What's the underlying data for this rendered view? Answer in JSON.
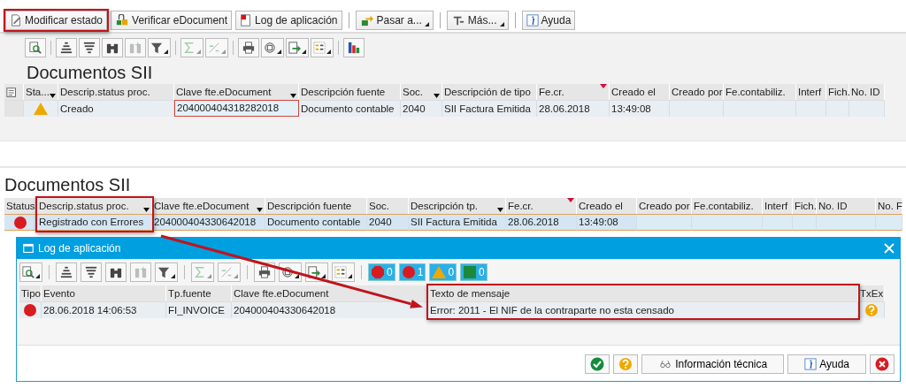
{
  "toolbar": [
    {
      "kind": "edit",
      "label": "Modificar estado",
      "dropdown": false,
      "separator_before": false,
      "highlighted": true
    },
    {
      "kind": "verify",
      "label": "Verificar eDocument",
      "dropdown": false,
      "separator_before": false,
      "highlighted": false
    },
    {
      "kind": "log",
      "label": "Log de aplicación",
      "dropdown": false,
      "separator_before": false,
      "highlighted": false
    },
    {
      "kind": "forward",
      "label": "Pasar a...",
      "dropdown": true,
      "separator_before": true,
      "highlighted": false
    },
    {
      "kind": "more",
      "label": "Más...",
      "dropdown": true,
      "separator_before": true,
      "highlighted": false
    },
    {
      "kind": "info",
      "label": "Ayuda",
      "dropdown": false,
      "separator_before": true,
      "highlighted": false
    }
  ],
  "first_list": {
    "alv_toolbar": [
      {
        "kind": "details",
        "dropdown": false,
        "disabled": false
      },
      {
        "kind": "separator"
      },
      {
        "kind": "sort_up",
        "dropdown": false,
        "disabled": false
      },
      {
        "kind": "sort_down",
        "dropdown": false,
        "disabled": false
      },
      {
        "kind": "find",
        "dropdown": false,
        "disabled": false
      },
      {
        "kind": "find_next",
        "dropdown": false,
        "disabled": true
      },
      {
        "kind": "filter",
        "dropdown": true,
        "disabled": false
      },
      {
        "kind": "separator"
      },
      {
        "kind": "sum",
        "dropdown": true,
        "disabled": true
      },
      {
        "kind": "subtotal",
        "dropdown": true,
        "disabled": true
      },
      {
        "kind": "separator"
      },
      {
        "kind": "print",
        "dropdown": false,
        "disabled": false
      },
      {
        "kind": "view",
        "dropdown": true,
        "disabled": false
      },
      {
        "kind": "export",
        "dropdown": true,
        "disabled": false
      },
      {
        "kind": "layout",
        "dropdown": true,
        "disabled": false
      },
      {
        "kind": "separator"
      },
      {
        "kind": "chart",
        "dropdown": false,
        "disabled": false
      }
    ],
    "title": "Documentos SII",
    "table": {
      "row_selector": true,
      "columns": [
        {
          "label": "Sta...",
          "filtered": true,
          "sorted": false,
          "highlighted": false
        },
        {
          "label": "Descrip.status proc.",
          "filtered": false,
          "sorted": false,
          "highlighted": false
        },
        {
          "label": "Clave fte.eDocument",
          "filtered": true,
          "sorted": false,
          "highlighted": false
        },
        {
          "label": "Descripción fuente",
          "filtered": false,
          "sorted": false,
          "highlighted": false
        },
        {
          "label": "Soc.",
          "filtered": true,
          "sorted": false,
          "highlighted": false
        },
        {
          "label": "Descripción de tipo",
          "filtered": false,
          "sorted": false,
          "highlighted": false
        },
        {
          "label": "Fe.cr.",
          "filtered": false,
          "sorted": true,
          "highlighted": false
        },
        {
          "label": "Creado el",
          "filtered": false,
          "sorted": false,
          "highlighted": false
        },
        {
          "label": "Creado por",
          "filtered": false,
          "sorted": false,
          "highlighted": false
        },
        {
          "label": "Fe.contabiliz.",
          "filtered": false,
          "sorted": false,
          "highlighted": false
        },
        {
          "label": "Interf",
          "filtered": false,
          "sorted": false,
          "highlighted": false
        },
        {
          "label": "Fich.",
          "filtered": false,
          "sorted": false,
          "highlighted": false
        },
        {
          "label": "No. ID",
          "filtered": false,
          "sorted": false,
          "highlighted": false
        }
      ],
      "rows": [
        {
          "selected": false,
          "cells": [
            {
              "kind": "warning"
            },
            {
              "text": "Creado",
              "focused": false
            },
            {
              "text": "204000404318282018",
              "focused": true
            },
            {
              "text": "Documento contable",
              "focused": false
            },
            {
              "text": "2040",
              "focused": false
            },
            {
              "text": "SII Factura Emitida",
              "focused": false
            },
            {
              "text": "28.06.2018",
              "focused": false
            },
            {
              "text": "13:49:08",
              "focused": false
            }
          ]
        }
      ]
    }
  },
  "second_list": {
    "title": "Documentos SII",
    "table": {
      "columns": [
        {
          "label": "Status",
          "filtered": false,
          "sorted": false,
          "highlighted": false
        },
        {
          "label": "Descrip.status proc.",
          "filtered": true,
          "sorted": false,
          "highlighted": true
        },
        {
          "label": "Clave fte.eDocument",
          "filtered": true,
          "sorted": false,
          "highlighted": false
        },
        {
          "label": "Descripción fuente",
          "filtered": false,
          "sorted": false,
          "highlighted": false
        },
        {
          "label": "Soc.",
          "filtered": false,
          "sorted": false,
          "highlighted": false
        },
        {
          "label": "Descripción tp.",
          "filtered": true,
          "sorted": false,
          "highlighted": false
        },
        {
          "label": "Fe.cr.",
          "filtered": false,
          "sorted": true,
          "highlighted": false
        },
        {
          "label": "Creado el",
          "filtered": false,
          "sorted": false,
          "highlighted": false
        },
        {
          "label": "Creado por",
          "filtered": false,
          "sorted": false,
          "highlighted": false
        },
        {
          "label": "Fe.contabiliz.",
          "filtered": false,
          "sorted": false,
          "highlighted": false
        },
        {
          "label": "Interf",
          "filtered": false,
          "sorted": false,
          "highlighted": false
        },
        {
          "label": "Fich.",
          "filtered": false,
          "sorted": false,
          "highlighted": false
        },
        {
          "label": "No. ID",
          "filtered": false,
          "sorted": false,
          "highlighted": false
        },
        {
          "label": "No. F",
          "filtered": false,
          "sorted": false,
          "highlighted": false
        }
      ],
      "rows": [
        {
          "selected": true,
          "cells": [
            {
              "kind": "error"
            },
            {
              "text": "Registrado con Errores",
              "focused": false
            },
            {
              "text": "204000404330642018",
              "focused": false
            },
            {
              "text": "Documento contable",
              "focused": false
            },
            {
              "text": "2040",
              "focused": false
            },
            {
              "text": "SII Factura Emitida",
              "focused": false
            },
            {
              "text": "28.06.2018",
              "focused": false
            },
            {
              "text": "13:49:08",
              "focused": false
            }
          ]
        }
      ]
    }
  },
  "dialog": {
    "title": "Log de aplicación",
    "alv_toolbar": [
      {
        "kind": "details",
        "dropdown": true,
        "disabled": false
      },
      {
        "kind": "separator"
      },
      {
        "kind": "sort_up",
        "dropdown": false,
        "disabled": false
      },
      {
        "kind": "sort_down",
        "dropdown": false,
        "disabled": false
      },
      {
        "kind": "find",
        "dropdown": false,
        "disabled": false
      },
      {
        "kind": "find_next",
        "dropdown": false,
        "disabled": true
      },
      {
        "kind": "filter",
        "dropdown": true,
        "disabled": false
      },
      {
        "kind": "separator"
      },
      {
        "kind": "sum",
        "dropdown": true,
        "disabled": true
      },
      {
        "kind": "subtotal",
        "dropdown": true,
        "disabled": true
      },
      {
        "kind": "separator"
      },
      {
        "kind": "print",
        "dropdown": false,
        "disabled": false
      },
      {
        "kind": "view",
        "dropdown": true,
        "disabled": false
      },
      {
        "kind": "export",
        "dropdown": true,
        "disabled": false
      },
      {
        "kind": "layout",
        "dropdown": true,
        "disabled": false
      },
      {
        "kind": "separator"
      }
    ],
    "message_filters": [
      {
        "kind": "stop",
        "count": "0"
      },
      {
        "kind": "error",
        "count": "1"
      },
      {
        "kind": "warning",
        "count": "0"
      },
      {
        "kind": "success",
        "count": "0"
      }
    ],
    "table": {
      "columns": [
        {
          "label": "Tipo",
          "filtered": false,
          "sorted": false,
          "highlighted": false
        },
        {
          "label": "Evento",
          "filtered": false,
          "sorted": false,
          "highlighted": false
        },
        {
          "label": "Tp.fuente",
          "filtered": false,
          "sorted": false,
          "highlighted": false
        },
        {
          "label": "Clave fte.eDocument",
          "filtered": false,
          "sorted": false,
          "highlighted": false
        },
        {
          "label": "Texto de mensaje",
          "filtered": false,
          "sorted": false,
          "highlighted": true
        },
        {
          "label": "TxEx",
          "filtered": false,
          "sorted": false,
          "highlighted": false
        }
      ],
      "rows": [
        {
          "selected": false,
          "cells": [
            {
              "kind": "error"
            },
            {
              "text": "28.06.2018 14:06:53",
              "focused": false
            },
            {
              "text": "FI_INVOICE",
              "focused": false
            },
            {
              "text": "204000404330642018",
              "focused": false
            },
            {
              "text": "Error: 2011 - El NIF de la contraparte no esta censado",
              "focused": false
            },
            {
              "kind": "help"
            }
          ]
        }
      ]
    },
    "buttons": [
      {
        "kind": "confirm"
      },
      {
        "kind": "help"
      },
      {
        "kind": "technical",
        "label": "Información técnica"
      },
      {
        "kind": "info",
        "label": "Ayuda"
      },
      {
        "kind": "cancel"
      }
    ]
  }
}
